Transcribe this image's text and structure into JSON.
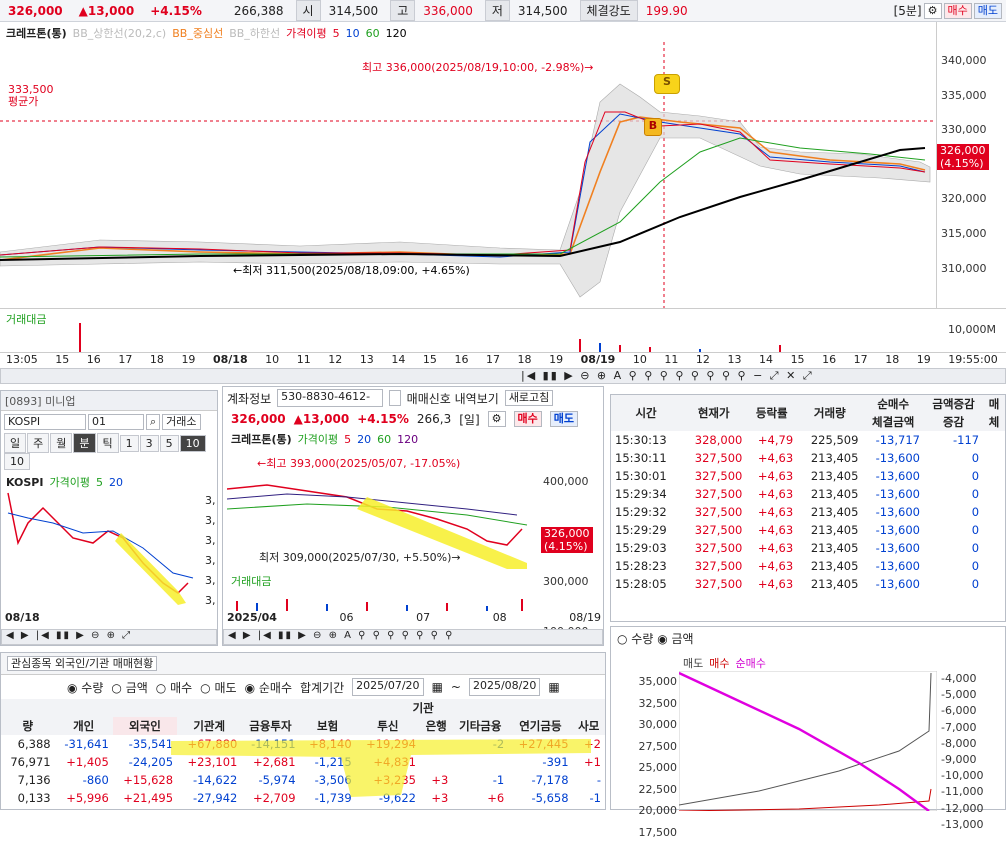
{
  "top": {
    "price": "326,000",
    "change": "▲13,000",
    "rate": "+4.15%",
    "volume": "266,388",
    "hi_lab": "시",
    "open": "314,500",
    "go_lab": "고",
    "high": "336,000",
    "lo_lab": "저",
    "low": "314,500",
    "str_lab": "체결강도",
    "strength": "199.90",
    "period": "[5분]",
    "sell": "매수",
    "buy": "매도"
  },
  "main": {
    "name": "크레프톤(통)",
    "bb_up": "BB_상한선(20,2,c)",
    "bb_mid": "BB_중심선",
    "bb_low": "BB_하한선",
    "ma_lab": "가격이평",
    "ma5": "5",
    "ma10": "10",
    "ma60": "60",
    "ma120": "120",
    "avg_price": "333,500",
    "avg_lab": "평균가",
    "high_note": "최고 336,000(2025/08/19,10:00, -2.98%)→",
    "low_note": "←최저 311,500(2025/08/18,09:00, +4.65%)",
    "cur_price": "326,000",
    "cur_rate": "(4.15%)",
    "vol_lab": "거래대금",
    "vol_axis": "10,000M",
    "y_labels": [
      "340,000",
      "335,000",
      "330,000",
      "325,000",
      "320,000",
      "315,000",
      "310,000"
    ],
    "x_labels": [
      "13:05",
      "15",
      "16",
      "17",
      "18",
      "19",
      "08/18",
      "10",
      "11",
      "12",
      "13",
      "14",
      "15",
      "16",
      "17",
      "18",
      "19",
      "08/19",
      "10",
      "11",
      "12",
      "13",
      "14",
      "15",
      "16",
      "17",
      "18",
      "19",
      "19:55:00"
    ],
    "mark_s": "S",
    "mark_b": "B"
  },
  "kospi": {
    "code": "[0893] 미니업",
    "name": "KOSPI",
    "code_in": "01",
    "exch": "거래소",
    "periods": [
      "일",
      "주",
      "월",
      "분",
      "틱",
      "1",
      "3",
      "5",
      "10",
      "10"
    ],
    "lab": "KOSPI",
    "ma_lab": "가격이평",
    "ma5": "5",
    "ma20": "20",
    "date": "08/18",
    "rlabels": [
      "3,",
      "3,",
      "3,",
      "3,",
      "3,",
      "3,"
    ]
  },
  "mini": {
    "acct_lab": "계좌정보",
    "acct": "530-8830-4612-",
    "signal": "매매신호 내역보기",
    "refresh": "새로고침",
    "price": "326,000",
    "change": "▲13,000",
    "rate": "+4.15%",
    "vol": "266,3",
    "period": "[일]",
    "sell": "매수",
    "buy": "매도",
    "name": "크레프톤(통)",
    "ma_lab": "가격이평",
    "ma5": "5",
    "ma20": "20",
    "ma60": "60",
    "ma120": "120",
    "high_note": "←최고 393,000(2025/05/07, -17.05%)",
    "low_note": "최저 309,000(2025/07/30, +5.50%)→",
    "y_labels": [
      "400,000",
      "350,000",
      "300,000",
      "100,000"
    ],
    "cur_price": "326,000",
    "cur_rate": "(4.15%)",
    "vol_lab": "거래대금",
    "x_labels": [
      "2025/04",
      "06",
      "07",
      "08",
      "08/19"
    ]
  },
  "ticks": {
    "headers": [
      "시간",
      "현재가",
      "등락률",
      "거래량",
      "순매수",
      "금액증감",
      "매"
    ],
    "sub": [
      "체결금액",
      "증감",
      "체"
    ],
    "rows": [
      [
        "15:30:13",
        "328,000",
        "+4,79",
        "225,509",
        "-13,717",
        "-117"
      ],
      [
        "15:30:11",
        "327,500",
        "+4,63",
        "213,405",
        "-13,600",
        "0"
      ],
      [
        "15:30:01",
        "327,500",
        "+4,63",
        "213,405",
        "-13,600",
        "0"
      ],
      [
        "15:29:34",
        "327,500",
        "+4,63",
        "213,405",
        "-13,600",
        "0"
      ],
      [
        "15:29:32",
        "327,500",
        "+4,63",
        "213,405",
        "-13,600",
        "0"
      ],
      [
        "15:29:29",
        "327,500",
        "+4,63",
        "213,405",
        "-13,600",
        "0"
      ],
      [
        "15:29:03",
        "327,500",
        "+4,63",
        "213,405",
        "-13,600",
        "0"
      ],
      [
        "15:28:23",
        "327,500",
        "+4,63",
        "213,405",
        "-13,600",
        "0"
      ],
      [
        "15:28:05",
        "327,500",
        "+4,63",
        "213,405",
        "-13,600",
        "0"
      ]
    ]
  },
  "flow": {
    "opt_qty": "수량",
    "opt_amt": "금액",
    "legend": [
      "매도",
      "매수",
      "순매수"
    ],
    "left_axis": [
      "35,000",
      "32,500",
      "30,000",
      "27,500",
      "25,000",
      "22,500",
      "20,000",
      "17,500"
    ],
    "right_axis": [
      "-4,000",
      "-5,000",
      "-6,000",
      "-7,000",
      "-8,000",
      "-9,000",
      "-10,000",
      "-11,000",
      "-12,000",
      "-13,000"
    ]
  },
  "inv": {
    "tab": "관심종목 외국인/기관 매매현황",
    "opt_qty": "수량",
    "opt_amt": "금액",
    "opt_buy": "매수",
    "opt_sell": "매도",
    "opt_net": "순매수",
    "period_lab": "합계기간",
    "from": "2025/07/20",
    "to": "2025/08/20",
    "group": "기관",
    "headers": [
      "량",
      "개인",
      "외국인",
      "기관계",
      "금융투자",
      "보험",
      "투신",
      "은행",
      "기타금융",
      "연기금등",
      "사모"
    ],
    "rows": [
      [
        "6,388",
        "-31,641",
        "-35,541",
        "+67,880",
        "-14,151",
        "+8,140",
        "+19,294",
        "",
        "-2",
        "+27,445",
        "+2"
      ],
      [
        "76,971",
        "+1,405",
        "-24,205",
        "+23,101",
        "+2,681",
        "-1,215",
        "+4,831",
        "",
        "",
        "-391",
        "+1"
      ],
      [
        "7,136",
        "-860",
        "+15,628",
        "-14,622",
        "-5,974",
        "-3,506",
        "+3,235",
        "+3",
        "-1",
        "-7,178",
        "-"
      ],
      [
        "0,133",
        "+5,996",
        "+21,495",
        "-27,942",
        "+2,709",
        "-1,739",
        "-9,622",
        "+3",
        "+6",
        "-5,658",
        "-1"
      ]
    ]
  }
}
